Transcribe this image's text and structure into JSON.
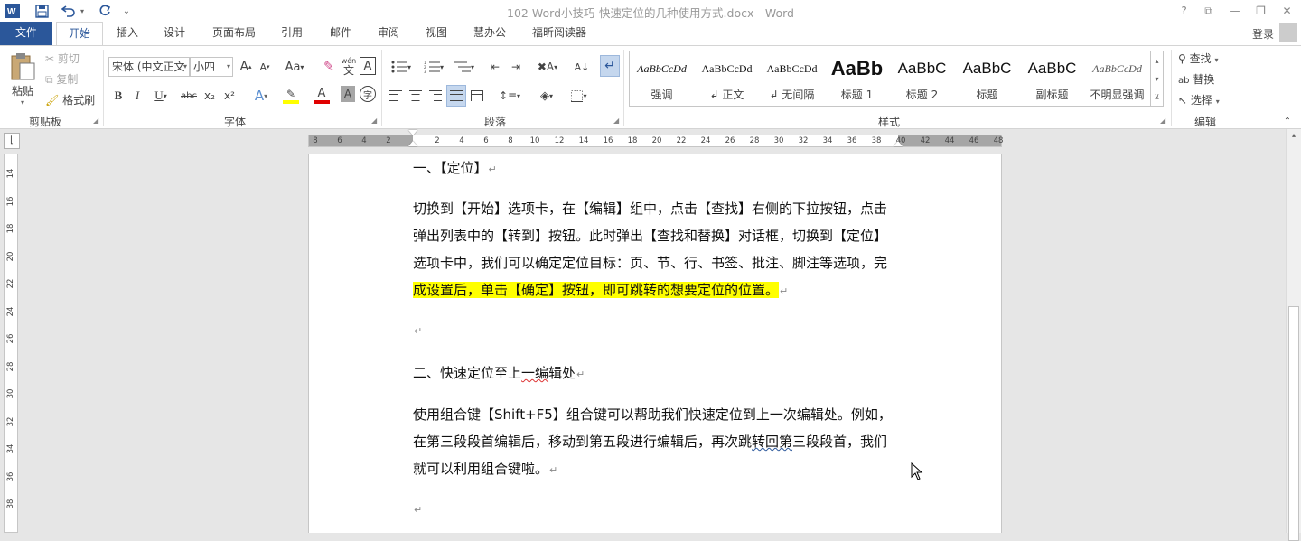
{
  "window": {
    "title": "102-Word小技巧-快速定位的几种使用方式.docx - Word",
    "help": "?",
    "controls": [
      "⧉",
      "—",
      "❐",
      "✕"
    ]
  },
  "qat": {
    "save_icon": "save-icon",
    "undo_icon": "undo-icon",
    "redo_icon": "redo-icon",
    "customize": "⌄"
  },
  "tabs": [
    {
      "label": "文件"
    },
    {
      "label": "开始"
    },
    {
      "label": "插入"
    },
    {
      "label": "设计"
    },
    {
      "label": "页面布局"
    },
    {
      "label": "引用"
    },
    {
      "label": "邮件"
    },
    {
      "label": "审阅"
    },
    {
      "label": "视图"
    },
    {
      "label": "慧办公"
    },
    {
      "label": "福昕阅读器"
    }
  ],
  "account": {
    "login": "登录"
  },
  "ribbon": {
    "clipboard": {
      "paste": "粘贴",
      "cut": "剪切",
      "copy": "复制",
      "format_painter": "格式刷",
      "label": "剪贴板"
    },
    "font": {
      "font_name": "宋体 (中文正文",
      "font_size": "小四",
      "label": "字体",
      "btn_grow": "A",
      "btn_shrink": "A",
      "btn_case": "Aa",
      "btn_bold": "B",
      "btn_italic": "I",
      "btn_underline": "U",
      "btn_strike": "abc",
      "btn_sub": "x₂",
      "btn_sup": "x²",
      "btn_effects": "A",
      "btn_color": "A",
      "btn_shade": "A",
      "btn_circle": "字",
      "btn_pinyin": "wén",
      "btn_border": "A"
    },
    "paragraph": {
      "label": "段落"
    },
    "styles": {
      "label": "样式",
      "items": [
        {
          "sample": "AaBbCcDd",
          "name": "强调"
        },
        {
          "sample": "AaBbCcDd",
          "name": "↲ 正文"
        },
        {
          "sample": "AaBbCcDd",
          "name": "↲ 无间隔"
        },
        {
          "sample": "AaBb",
          "name": "标题 1"
        },
        {
          "sample": "AaBbC",
          "name": "标题 2"
        },
        {
          "sample": "AaBbC",
          "name": "标题"
        },
        {
          "sample": "AaBbC",
          "name": "副标题"
        },
        {
          "sample": "AaBbCcDd",
          "name": "不明显强调"
        }
      ]
    },
    "editing": {
      "find": "查找",
      "replace": "替换",
      "select": "选择",
      "label": "编辑"
    }
  },
  "ruler": {
    "h_ticks": [
      "8",
      "6",
      "4",
      "2",
      "2",
      "4",
      "6",
      "8",
      "10",
      "12",
      "14",
      "16",
      "18",
      "20",
      "22",
      "24",
      "26",
      "28",
      "30",
      "32",
      "34",
      "36",
      "38",
      "40",
      "42",
      "44",
      "46",
      "48"
    ],
    "v_ticks": [
      "14",
      "16",
      "18",
      "20",
      "22",
      "24",
      "26",
      "28",
      "30",
      "32",
      "34",
      "36",
      "38"
    ]
  },
  "document": {
    "h1": "一、【定位】",
    "p1_l1": "切换到【开始】选项卡，在【编辑】组中，点击【查找】右侧的下拉按钮，点击",
    "p1_l2": "弹出列表中的【转到】按钮。此时弹出【查找和替换】对话框，切换到【定位】",
    "p1_l3": "选项卡中，我们可以确定定位目标：页、节、行、书签、批注、脚注等选项，完",
    "p1_l4": "成设置后，单击【确定】按钮，即可跳转的想要定位的位置。",
    "h2_a": "二、快速定位至上",
    "h2_b": "一编",
    "h2_c": "辑处",
    "p2_l1": "使用组合键【Shift+F5】组合键可以帮助我们快速定位到上一次编辑处。例如，",
    "p2_l2_a": "在第三段段首编辑后，移动到第五段进行编辑后，再次跳",
    "p2_l2_b": "转回第",
    "p2_l2_c": "三段段首，我们",
    "p2_l3": "就可以利用组合键啦。",
    "para_mark": "↵"
  }
}
